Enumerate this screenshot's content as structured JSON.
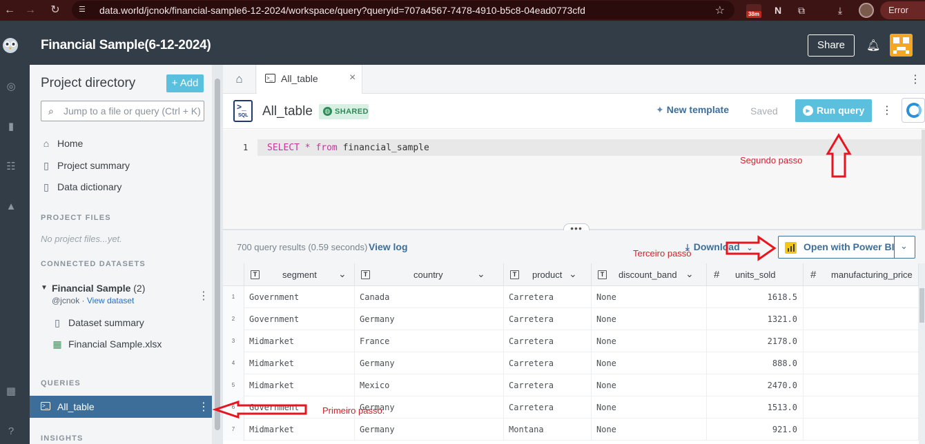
{
  "browser": {
    "url": "data.world/jcnok/financial-sample6-12-2024/workspace/query?queryid=707a4567-7478-4910-b5c8-04ead0773cfd",
    "ext_badge": "38m",
    "error_label": "Error"
  },
  "header": {
    "project_title": "Financial Sample(6-12-2024)",
    "share_label": "Share"
  },
  "sidebar": {
    "title": "Project directory",
    "add_label": "+ Add",
    "search_placeholder": "Jump to a file or query (Ctrl + K)",
    "nav": [
      {
        "label": "Home",
        "icon": "home-icon"
      },
      {
        "label": "Project summary",
        "icon": "document-icon"
      },
      {
        "label": "Data dictionary",
        "icon": "document-icon"
      }
    ],
    "project_files_heading": "PROJECT FILES",
    "no_files": "No project files...yet.",
    "connected_heading": "CONNECTED DATASETS",
    "dataset": {
      "name": "Financial Sample",
      "count": "(2)",
      "owner": "@jcnok",
      "separator": "·",
      "view_link": "View dataset",
      "items": [
        {
          "label": "Dataset summary",
          "icon": "document-icon"
        },
        {
          "label": "Financial Sample.xlsx",
          "icon": "spreadsheet-icon"
        }
      ]
    },
    "queries_heading": "QUERIES",
    "query_item": "All_table",
    "insights_heading": "INSIGHTS"
  },
  "tabs": {
    "active_tab": "All_table"
  },
  "query": {
    "title": "All_table",
    "badge": "SHARED",
    "new_template": "New template",
    "saved": "Saved",
    "run": "Run query",
    "line_number": "1",
    "code": {
      "kw1": "SELECT",
      "star": " * ",
      "kw2": "from",
      "rest": " financial_sample"
    }
  },
  "results": {
    "summary": "700 query results (0.59 seconds)",
    "view_log": "View log",
    "download": "Download",
    "power_bi": "Open with Power BI",
    "columns": [
      {
        "name": "segment",
        "type": "text"
      },
      {
        "name": "country",
        "type": "text"
      },
      {
        "name": "product",
        "type": "text"
      },
      {
        "name": "discount_band",
        "type": "text"
      },
      {
        "name": "units_sold",
        "type": "number"
      },
      {
        "name": "manufacturing_price",
        "type": "number"
      }
    ],
    "rows": [
      {
        "n": "1",
        "segment": "Government",
        "country": "Canada",
        "product": "Carretera",
        "discount_band": "None",
        "units_sold": "1618.5"
      },
      {
        "n": "2",
        "segment": "Government",
        "country": "Germany",
        "product": "Carretera",
        "discount_band": "None",
        "units_sold": "1321.0"
      },
      {
        "n": "3",
        "segment": "Midmarket",
        "country": "France",
        "product": "Carretera",
        "discount_band": "None",
        "units_sold": "2178.0"
      },
      {
        "n": "4",
        "segment": "Midmarket",
        "country": "Germany",
        "product": "Carretera",
        "discount_band": "None",
        "units_sold": "888.0"
      },
      {
        "n": "5",
        "segment": "Midmarket",
        "country": "Mexico",
        "product": "Carretera",
        "discount_band": "None",
        "units_sold": "2470.0"
      },
      {
        "n": "6",
        "segment": "Government",
        "country": "Germany",
        "product": "Carretera",
        "discount_band": "None",
        "units_sold": "1513.0"
      },
      {
        "n": "7",
        "segment": "Midmarket",
        "country": "Germany",
        "product": "Montana",
        "discount_band": "None",
        "units_sold": "921.0"
      }
    ]
  },
  "annotations": {
    "step1": "Primeiro passo.",
    "step2": "Segundo passo",
    "step3": "Terceiro passo",
    "arrow_color": "#e8141e"
  },
  "colors": {
    "chrome": "#3c1414",
    "appbar": "#333d47",
    "accent": "#5bc0de",
    "selected": "#3d6e99",
    "shared_green": "#2e8b57"
  }
}
